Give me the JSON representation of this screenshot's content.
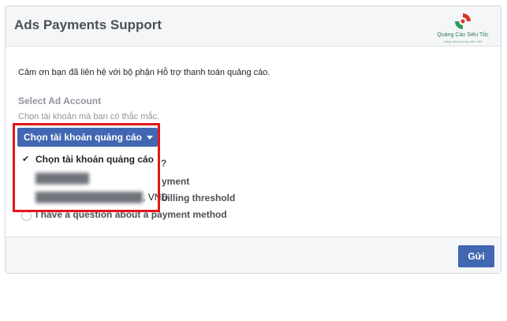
{
  "header": {
    "title": "Ads Payments Support"
  },
  "logo": {
    "text": "Quảng Cáo Siêu Tốc",
    "subtext": "Nâng tầm thương hiệu Việt"
  },
  "form": {
    "intro": "Cảm ơn bạn đã liên hệ với bộ phận Hỗ trợ thanh toán quảng cáo.",
    "section_label": "Select Ad Account",
    "hint": "Chọn tài khoản mà ban có thắc mắc.",
    "account_select": {
      "label": "Chọn tài khoản quảng cáo",
      "options": [
        {
          "label": "Chọn tài khoản quảng cáo",
          "selected": true
        },
        {
          "label": "Hidden ad account",
          "hidden": true
        },
        {
          "label": "Hidden ad account",
          "hidden": true,
          "suffix": ", VND"
        }
      ]
    },
    "partial_questions": {
      "q_mark": "?",
      "payment": "yment",
      "billing": "billing threshold",
      "payment_method": "I have a question about a payment method"
    }
  },
  "footer": {
    "submit_label": "Gửi"
  },
  "colors": {
    "accent": "#4267b2",
    "highlight": "#e3151a"
  }
}
